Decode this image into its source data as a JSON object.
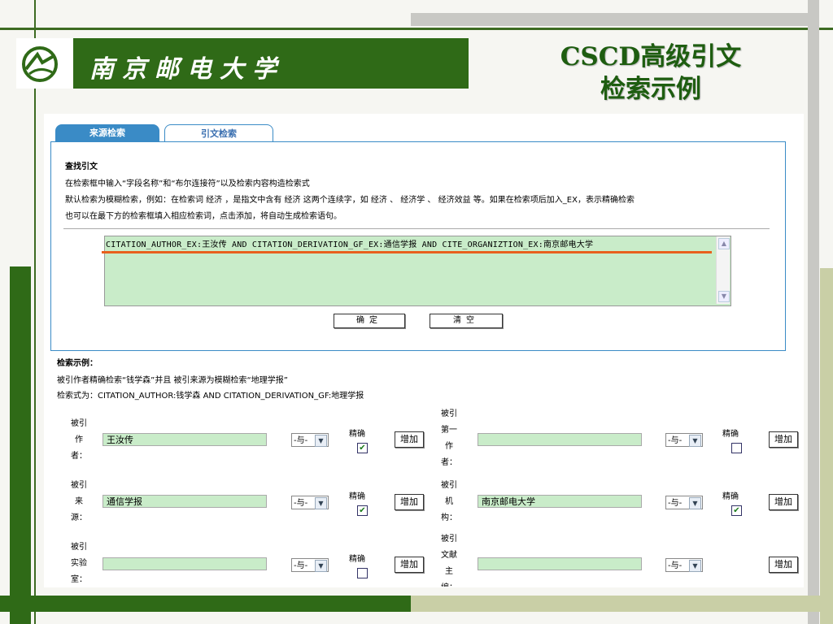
{
  "slide": {
    "university": "南京邮电大学",
    "title_line1": "CSCD高级引文",
    "title_line2": "检索示例"
  },
  "tabs": [
    "来源检索",
    "引文检索"
  ],
  "panel": {
    "heading": "查找引文",
    "line1": "在检索框中输入“字段名称”和“布尔连接符”以及检索内容构造检索式",
    "line2": "默认检索为模糊检索，例如：在检索词 经济 ，是指文中含有 经济 这两个连续字，如 经济 、 经济学 、 经济效益 等。如果在检索项后加入_EX，表示精确检索",
    "line3": "也可以在最下方的检索框填入相应检索词，点击添加，将自动生成检索语句。",
    "query": "CITATION_AUTHOR_EX:王汝传 AND CITATION_DERIVATION_GF_EX:通信学报 AND CITE_ORGANIZTION_EX:南京邮电大学",
    "confirm": "确定",
    "clear": "清空"
  },
  "example": {
    "heading": "检索示例：",
    "desc": "被引作者精确检索“钱学森”并且 被引来源为模糊检索“地理学报”",
    "expr": "检索式为：CITATION_AUTHOR:钱学森 AND CITATION_DERIVATION_GF:地理学报"
  },
  "form": {
    "left": [
      {
        "label": [
          "被引",
          "作",
          "者："
        ],
        "value": "王汝传",
        "op": "-与-",
        "exact_label": "精确",
        "checked": "✔",
        "add": "增加"
      },
      {
        "label": [
          "被引",
          "来",
          "源："
        ],
        "value": "通信学报",
        "op": "-与-",
        "exact_label": "精确",
        "checked": "✔",
        "add": "增加"
      },
      {
        "label": [
          "被引",
          "实验",
          "室："
        ],
        "value": "",
        "op": "-与-",
        "exact_label": "精确",
        "checked": "",
        "add": "增加"
      }
    ],
    "right": [
      {
        "label": [
          "被引",
          "第一",
          "作",
          "者："
        ],
        "value": "",
        "op": "-与-",
        "exact_label": "精确",
        "checked": "",
        "add": "增加"
      },
      {
        "label": [
          "被引",
          "机",
          "构："
        ],
        "value": "南京邮电大学",
        "op": "-与-",
        "exact_label": "精确",
        "checked": "✔",
        "add": "增加"
      },
      {
        "label": [
          "被引",
          "文献",
          "主",
          "编："
        ],
        "value": "",
        "op": "-与-",
        "exact_label": "",
        "checked": "",
        "add": "增加"
      }
    ]
  },
  "colors": {
    "green": "#2f6a17",
    "olive": "#c9cfa6",
    "query_bg": "#c9ecc9",
    "underline": "#e8601c",
    "tab_blue": "#3a8bc6"
  },
  "icons": [
    "logo-icon",
    "chevron-down-icon",
    "scroll-up-icon",
    "scroll-down-icon",
    "check-icon"
  ]
}
